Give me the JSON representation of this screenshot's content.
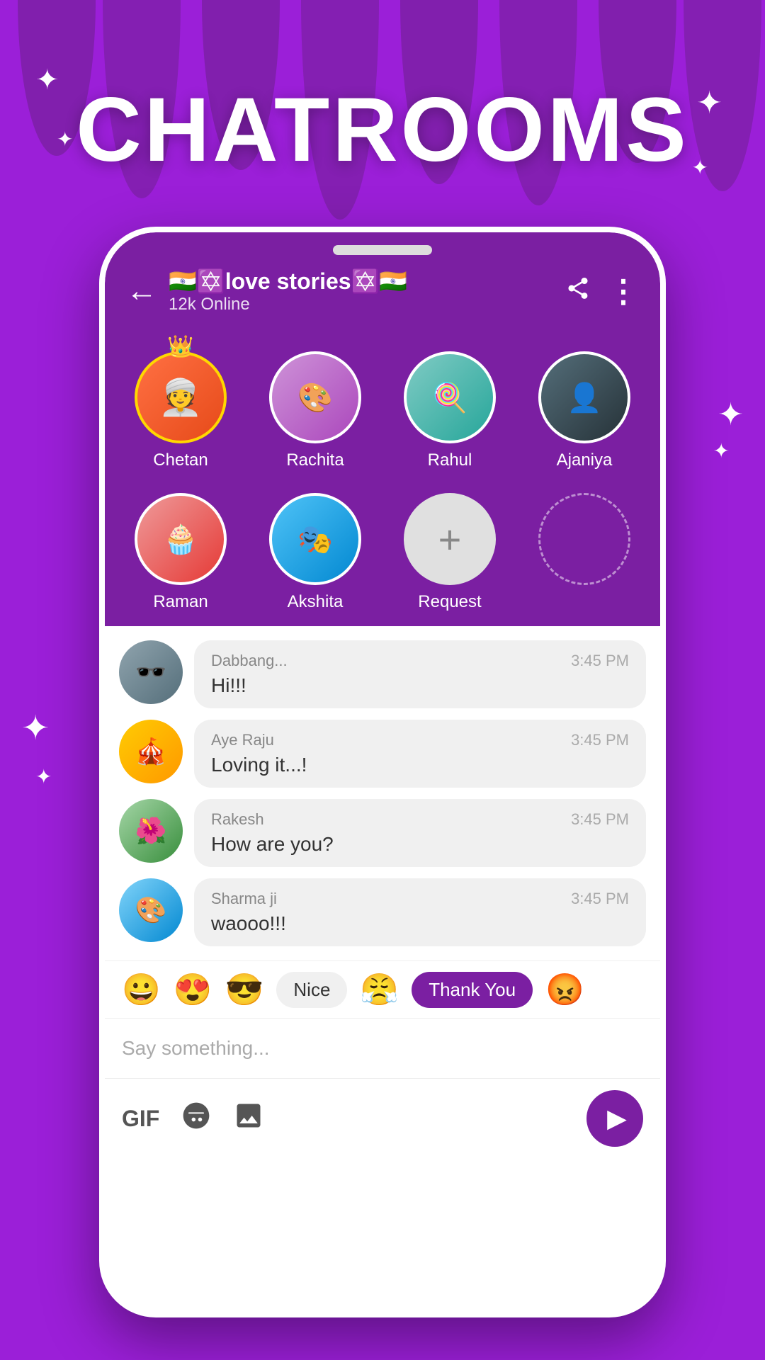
{
  "app": {
    "title": "CHATROOMS"
  },
  "header": {
    "back_label": "←",
    "room_name": "🇮🇳✡️love stories✡️🇮🇳",
    "online_count": "12k Online",
    "share_icon": "share",
    "more_icon": "⋮"
  },
  "users": [
    {
      "name": "Chetan",
      "featured": true,
      "avatar_class": "av-chetan",
      "emoji": "👳"
    },
    {
      "name": "Rachita",
      "featured": false,
      "avatar_class": "av-rachita",
      "emoji": "🎨"
    },
    {
      "name": "Rahul",
      "featured": false,
      "avatar_class": "av-rahul",
      "emoji": "🍭"
    },
    {
      "name": "Ajaniya",
      "featured": false,
      "avatar_class": "av-ajaniya",
      "emoji": "👤"
    },
    {
      "name": "Raman",
      "featured": false,
      "avatar_class": "av-raman",
      "emoji": "🧁"
    },
    {
      "name": "Akshita",
      "featured": false,
      "avatar_class": "av-akshita",
      "emoji": "🎭"
    },
    {
      "name": "Request",
      "featured": false,
      "is_add": true
    },
    {
      "name": "",
      "featured": false,
      "is_dashed": true
    }
  ],
  "messages": [
    {
      "avatar_class": "av-dabbang",
      "avatar_emoji": "🕶️",
      "sender": "Dabbang...",
      "time": "3:45 PM",
      "text": "Hi!!!"
    },
    {
      "avatar_class": "av-ayeraju",
      "avatar_emoji": "🎪",
      "sender": "Aye Raju",
      "time": "3:45 PM",
      "text": "Loving it...!"
    },
    {
      "avatar_class": "av-rakesh",
      "avatar_emoji": "🌺",
      "sender": "Rakesh",
      "time": "3:45 PM",
      "text": "How are you?"
    },
    {
      "avatar_class": "av-sharmaji",
      "avatar_emoji": "🎨",
      "sender": "Sharma ji",
      "time": "3:45 PM",
      "text": "waooo!!!"
    }
  ],
  "quick_reactions": [
    {
      "type": "emoji",
      "value": "😀"
    },
    {
      "type": "emoji",
      "value": "😍"
    },
    {
      "type": "emoji",
      "value": "😎"
    },
    {
      "type": "button",
      "value": "Nice"
    },
    {
      "type": "emoji",
      "value": "😤"
    },
    {
      "type": "button",
      "value": "Thank You",
      "selected": true
    },
    {
      "type": "emoji",
      "value": "😡"
    }
  ],
  "input": {
    "placeholder": "Say something..."
  },
  "toolbar": {
    "gif_label": "GIF",
    "sticker_label": "🙂",
    "image_label": "🖼️",
    "send_label": "▶"
  }
}
